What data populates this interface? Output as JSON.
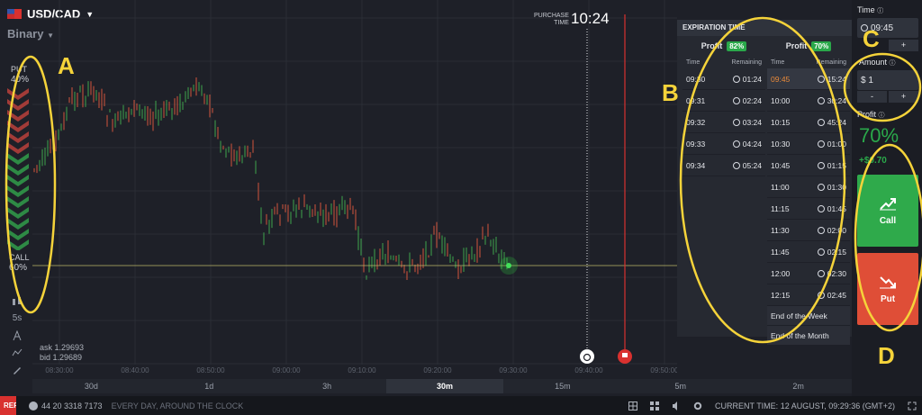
{
  "asset": {
    "name": "USD/CAD",
    "mode": "Binary",
    "flag": "canada-flag-icon"
  },
  "sentiment": {
    "put_label": "PUT",
    "put_pct": "40%",
    "call_label": "CALL",
    "call_pct": "60%"
  },
  "annotations": {
    "a": "A",
    "b": "B",
    "c": "C",
    "d": "D"
  },
  "tools": {
    "timeframe": "5s"
  },
  "quote": {
    "ask": "ask 1.29693",
    "bid": "bid 1.29689"
  },
  "purchase": {
    "label_line1": "PURCHASE",
    "label_line2": "TIME",
    "time": "10:24"
  },
  "x_axis_times": [
    "08:30:00",
    "08:40:00",
    "08:50:00",
    "09:00:00",
    "09:10:00",
    "09:20:00",
    "09:30:00",
    "09:40:00",
    "09:50:00",
    "10:00:00",
    "10:10:00"
  ],
  "timeframes": [
    {
      "label": "30d",
      "active": false
    },
    {
      "label": "1d",
      "active": false
    },
    {
      "label": "3h",
      "active": false
    },
    {
      "label": "30m",
      "active": true
    },
    {
      "label": "15m",
      "active": false
    },
    {
      "label": "5m",
      "active": false
    },
    {
      "label": "2m",
      "active": false
    }
  ],
  "status_bar": {
    "report": "REPORT",
    "phone": "44 20 3318 7173",
    "motto": "EVERY DAY, AROUND THE CLOCK",
    "current_time": "CURRENT TIME: 12 AUGUST, 09:29:36 (GMT+2)"
  },
  "expiration": {
    "title": "EXPIRATION TIME",
    "left": {
      "profit_label": "Profit",
      "profit_badge": "82%",
      "col_time": "Time",
      "col_remaining": "Remaining",
      "rows": [
        {
          "time": "09:30",
          "remaining": "01:24"
        },
        {
          "time": "09:31",
          "remaining": "02:24"
        },
        {
          "time": "09:32",
          "remaining": "03:24"
        },
        {
          "time": "09:33",
          "remaining": "04:24"
        },
        {
          "time": "09:34",
          "remaining": "05:24"
        }
      ]
    },
    "right": {
      "profit_label": "Profit",
      "profit_badge": "70%",
      "col_time": "Time",
      "col_remaining": "Remaining",
      "rows": [
        {
          "time": "09:45",
          "remaining": "15:24"
        },
        {
          "time": "10:00",
          "remaining": "30:24"
        },
        {
          "time": "10:15",
          "remaining": "45:24"
        },
        {
          "time": "10:30",
          "remaining": "01:00"
        },
        {
          "time": "10:45",
          "remaining": "01:15"
        },
        {
          "time": "11:00",
          "remaining": "01:30"
        },
        {
          "time": "11:15",
          "remaining": "01:45"
        },
        {
          "time": "11:30",
          "remaining": "02:00"
        },
        {
          "time": "11:45",
          "remaining": "02:15"
        },
        {
          "time": "12:00",
          "remaining": "02:30"
        },
        {
          "time": "12:15",
          "remaining": "02:45"
        }
      ],
      "end_week": "End of the Week",
      "end_month": "End of the Month"
    }
  },
  "trade": {
    "time_label": "Time",
    "time_value": "09:45",
    "amount_label": "Amount",
    "amount_value": "$ 1",
    "minus": "-",
    "plus": "+",
    "profit_label": "Profit",
    "profit_pct": "70%",
    "profit_amount": "+$0.70",
    "call_label": "Call",
    "put_label": "Put"
  },
  "colors": {
    "call": "#2faa4b",
    "put": "#df4e37",
    "highlight": "#f5d33a",
    "expiry_line": "#d9312f"
  }
}
